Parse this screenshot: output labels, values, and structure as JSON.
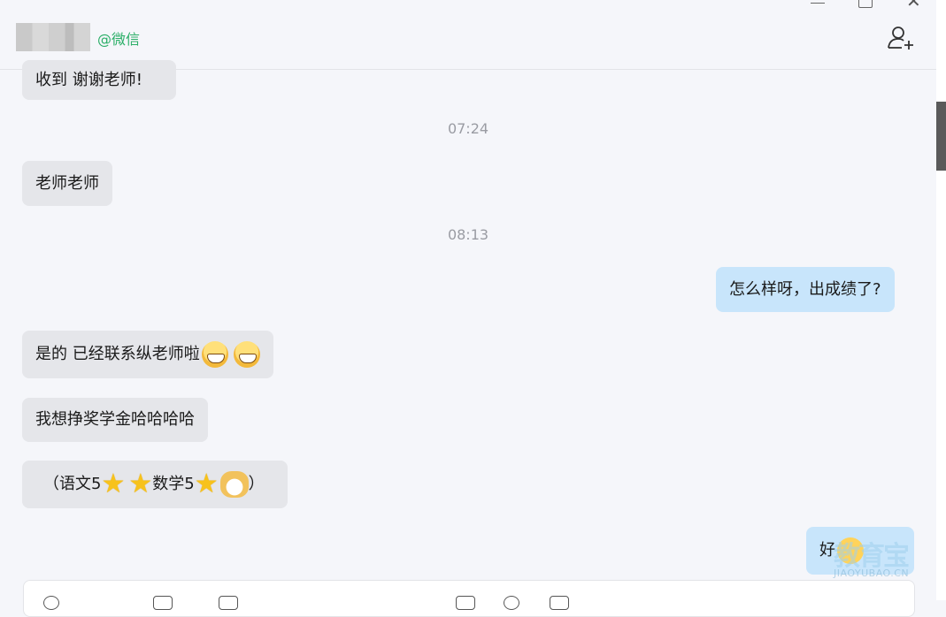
{
  "header": {
    "contact_handle": "@微信"
  },
  "timestamps": [
    "07:24",
    "08:13"
  ],
  "messages": {
    "m1": "收到 谢谢老师!",
    "m2": "老师老师",
    "m3": "怎么样呀，出成绩了?",
    "m4": "是的 已经联系纵老师啦",
    "m5": "我想挣奖学金哈哈哈哈",
    "m6_a": "（语文5",
    "m6_b": " 数学5",
    "m6_c": "）",
    "m7": "好"
  },
  "watermark": {
    "brand": "教育宝",
    "url": "JIAOYUBAO.CN"
  },
  "icons": [
    "minimize-icon",
    "maximize-icon",
    "close-icon",
    "add-user-icon",
    "grin-emoji",
    "star-emoji",
    "doge-emoji",
    "thumbs-up-emoji"
  ],
  "colors": {
    "sent_bubble": "#c8e5fb",
    "received_bubble": "#e5e6ea",
    "accent": "#2aae67"
  }
}
